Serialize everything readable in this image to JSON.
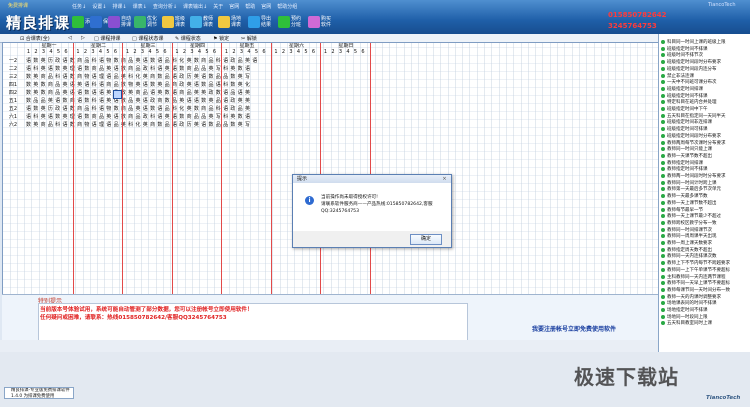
{
  "app": {
    "small_logo": "免费排课",
    "logo": "精良排课",
    "title_info": "TiancoTech",
    "menu": [
      "任务↓",
      "设置↓",
      "排课↓",
      "课表↓",
      "查询分析↓",
      "课表输出↓",
      "关于",
      "官网",
      "帮助",
      "官网",
      "帮助分组"
    ],
    "toolbar": [
      {
        "label": "添加",
        "icon": "plus-icon",
        "color": "#2fbf3a"
      },
      {
        "label": "保存",
        "icon": "save-icon",
        "color": "#2f6fd0"
      },
      {
        "label": "自动排课",
        "icon": "auto-schedule-icon",
        "color": "#8a4fd1"
      },
      {
        "label": "优化调节",
        "icon": "optimize-icon",
        "color": "#38b56a"
      },
      {
        "label": "班级课表",
        "icon": "class-table-icon",
        "color": "#f0c840"
      },
      {
        "label": "教师课表",
        "icon": "teacher-table-icon",
        "color": "#43b0e8"
      },
      {
        "label": "场地课表",
        "icon": "venue-table-icon",
        "color": "#f0c840"
      },
      {
        "label": "导出结果",
        "icon": "export-icon",
        "color": "#2f9ee8"
      },
      {
        "label": "预约分班",
        "icon": "group-icon",
        "color": "#2fbf3a"
      },
      {
        "label": "购买软件",
        "icon": "buy-icon",
        "color": "#d06ad6"
      }
    ],
    "phones": [
      "015850782642",
      "3245764753"
    ]
  },
  "subbar": {
    "items": [
      "⊡ 合课表(全)",
      "◁",
      "▷",
      "□ 课程排课",
      "□ 课程状态课",
      "✎ 课程状态",
      "⚑ 锁定",
      "✂ 解锁"
    ]
  },
  "schedule": {
    "days": [
      "星期一",
      "星期二",
      "星期三",
      "星期四",
      "星期五",
      "星期六",
      "星期日"
    ],
    "periods": [
      "1",
      "2",
      "3",
      "4",
      "5",
      "6"
    ],
    "rows": [
      "一2",
      "二2",
      "三2",
      "四1",
      "四2",
      "五1",
      "五2",
      "六1",
      "六2"
    ],
    "row_cells": [
      "语数英历政语数商品科语物数商品英语数语品科化英数商品科语政品英语",
      "语科英语数英理语数商品英语数商品政科语英语数商品品英写科英数语",
      "数英商品科语数商物语理语品英科化英商数品语政历英语数品品数英写",
      "数英数商品英语英语科语商品数物英语数英品商政英语数品语科数英化",
      "数英数商品英语语数语语英品政英商品语英数语商品英英政数语品语英",
      "数品品英语数商语数科语英语数品英语政商数品英语语数英品语政英英",
      "语数英历政语数商品科语物数商品英语数语品科化英数商品科语政品英",
      "语科英语数英理语数商品英语数商品政科语英语数商品品英写科英数语",
      "数英商品科语数商物语理语品英科化英商数品语政历英语数品品数英写"
    ]
  },
  "right_panel": {
    "items": [
      "科目同一时间上课的班级上限",
      "班级指定时间不排课",
      "班级时间不排节次",
      "班级指定时间段时分布要求",
      "班级指定时间段内连分布",
      "禁止非法连课",
      "一天中不同班可课分布次",
      "班级指定时间排课",
      "班级指定时间不排课",
      "特定科目在班内合并处理",
      "班级指定时间中下午",
      "五天科目在指定同一天同半天",
      "班级指定时间非连排课",
      "班级指定时间可排课",
      "班级指定时间段时分布要求",
      "教师两周每节次课时分布要求",
      "教师同一时间只能上课",
      "教师一天课节数不超出",
      "教师指定时间排课",
      "教师指定时间不排课",
      "教师两一时间段时时分布要求",
      "教师同一时间计时跨上课",
      "教师第一天最后多节次单元",
      "教师一天最多课节数",
      "教师一天上课节数不超出",
      "教师每节最早一节",
      "教师一天上课节最少不超过",
      "教师跨校区教学分布一致",
      "教师同一时间排课节次",
      "教师同一周周课半天出现",
      "教师一周上课天数要求",
      "教师指定周天数不超出",
      "教师同一天内连排课次数",
      "教师上下不节内每节不跨越要求",
      "教师同一上下午单课节不要超标",
      "主科教师同一天内连两节课程",
      "教师不同一天早上课节不要超标",
      "教师每课节同一天时间分布一致",
      "教师一天的内课时调整要求",
      "场地课表同的时间不排课",
      "场地指定时间不排课",
      "场地同一时段同上限",
      "五天科目教室同时上课"
    ]
  },
  "notice": {
    "title": "特别提示",
    "line1": "当前版本号体验试用，系统可能自动管测了部分数据，您可以注册帐号立即使用软件！",
    "line2": "任何疑问或困难，请联系：热线015850782642/客服QQ3245764753",
    "line3": "我要注册帐号立即免费使用软件"
  },
  "dialog": {
    "title": "提示",
    "close": "×",
    "icon": "info-icon",
    "message_lines": [
      "当前操作尚未取得授权许可!",
      "请联系软件服务商——产品热线:015850782642,客服QQ:3245764753"
    ],
    "ok": "确定"
  },
  "taskbar": {
    "item": "精良排课-专业版免费排课软件 1.4.0 为排课免费使用"
  },
  "watermark": "极速下载站",
  "brand": "TiancoTech"
}
